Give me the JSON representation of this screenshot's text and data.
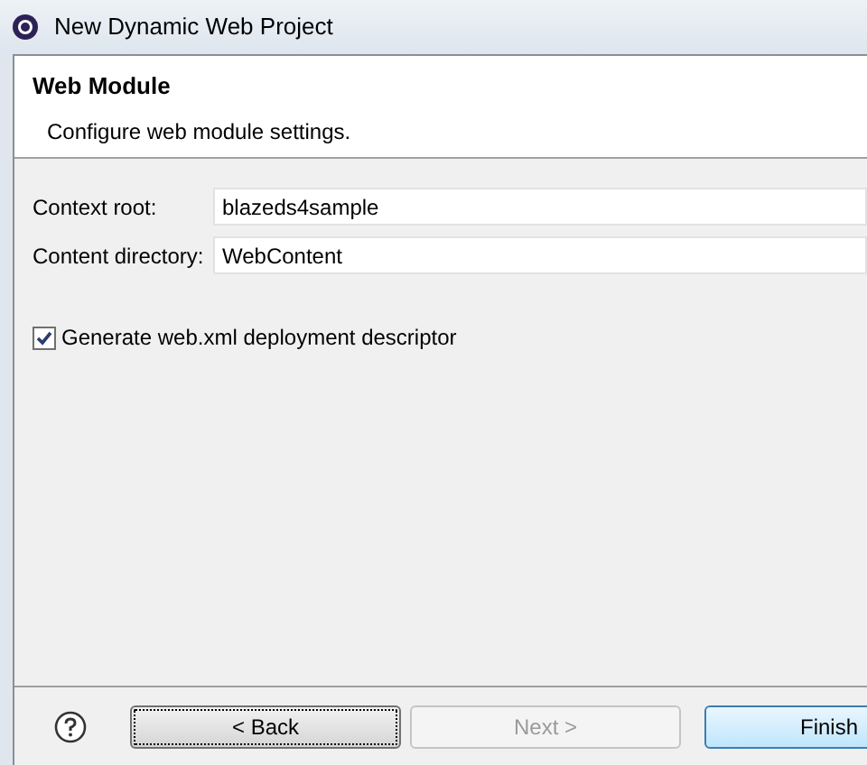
{
  "window": {
    "title": "New Dynamic Web Project"
  },
  "header": {
    "title": "Web Module",
    "description": "Configure web module settings."
  },
  "fields": [
    {
      "label": "Context root:",
      "value": "blazeds4sample"
    },
    {
      "label": "Content directory:",
      "value": "WebContent"
    }
  ],
  "options": [
    {
      "label": "Generate web.xml deployment descriptor",
      "checked": true
    }
  ],
  "buttons": [
    {
      "label": "< Back",
      "disabled": false,
      "default": false
    },
    {
      "label": "Next >",
      "disabled": true,
      "default": false
    },
    {
      "label": "Finish",
      "disabled": false,
      "default": true
    }
  ]
}
